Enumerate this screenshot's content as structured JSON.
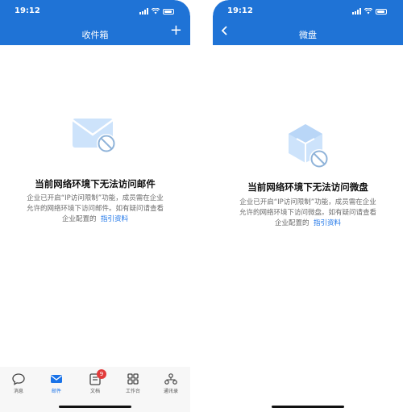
{
  "left_screen": {
    "status": {
      "time": "19:12"
    },
    "title": "收件箱",
    "illustration_icon": "mail-blocked-icon",
    "headline": "当前网络环境下无法访问邮件",
    "desc_lines": [
      "企业已开启“IP访问限制”功能，成员需在企业",
      "允许的网络环境下访问邮件。如有疑问请查看"
    ],
    "desc_tail": "企业配置的",
    "link_text": "指引资料",
    "tabs": [
      {
        "label": "消息",
        "icon": "message-icon"
      },
      {
        "label": "邮件",
        "icon": "mail-icon"
      },
      {
        "label": "文档",
        "icon": "document-icon",
        "badge": "9"
      },
      {
        "label": "工作台",
        "icon": "grid-icon"
      },
      {
        "label": "通讯录",
        "icon": "contacts-icon"
      }
    ],
    "active_tab": "邮件"
  },
  "right_screen": {
    "status": {
      "time": "19:12"
    },
    "title": "微盘",
    "illustration_icon": "drive-blocked-icon",
    "headline": "当前网络环境下无法访问微盘",
    "desc_lines": [
      "企业已开启“IP访问限制”功能，成员需在企业",
      "允许的网络环境下访问微盘。如有疑问请查看"
    ],
    "desc_tail": "企业配置的",
    "link_text": "指引资料"
  },
  "colors": {
    "header": "#1f73d6",
    "link": "#1a73e8",
    "text_secondary": "#6b6b6b"
  }
}
